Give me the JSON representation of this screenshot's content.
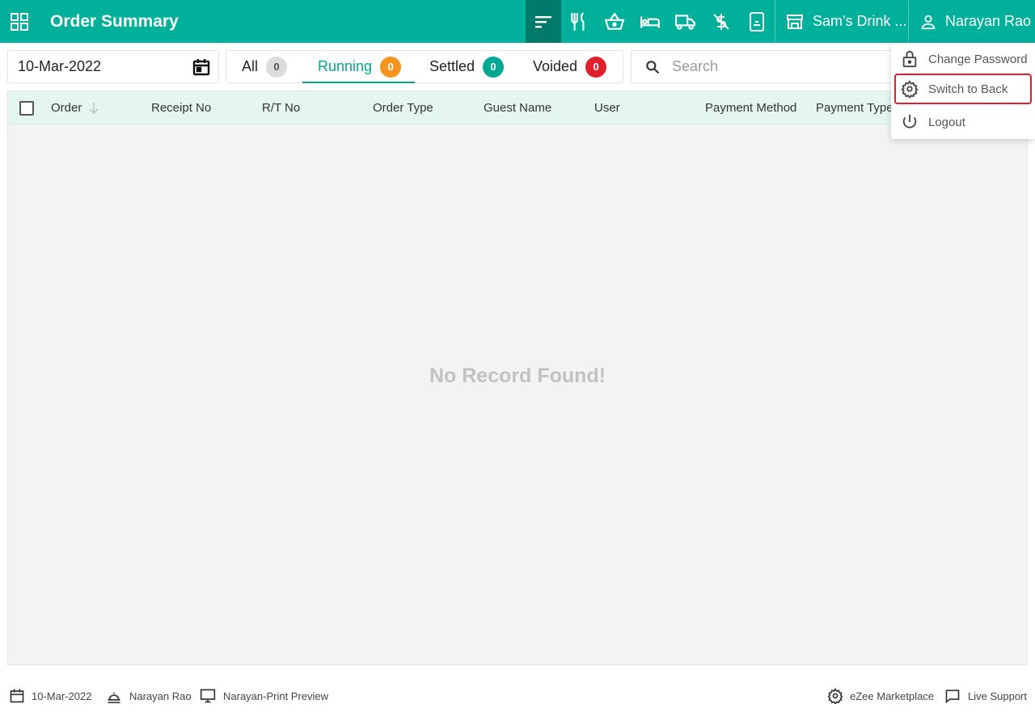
{
  "header": {
    "title": "Order Summary",
    "icons": [
      "sort-icon",
      "restaurant-icon",
      "basket-icon",
      "bed-icon",
      "truck-icon",
      "no-tip-icon",
      "tablet-icon"
    ],
    "outlet": "Sam's Drink ...",
    "user": "Narayan Rao"
  },
  "toolbar": {
    "date": "10-Mar-2022",
    "tabs": [
      {
        "label": "All",
        "count": "0",
        "color": "#dcdcdc",
        "text_color": "#555555"
      },
      {
        "label": "Running",
        "count": "0",
        "color": "#f7931e",
        "text_color": "#ffffff"
      },
      {
        "label": "Settled",
        "count": "0",
        "color": "#00a892",
        "text_color": "#ffffff"
      },
      {
        "label": "Voided",
        "count": "0",
        "color": "#e0202c",
        "text_color": "#ffffff"
      }
    ],
    "active_tab": "Running",
    "search_placeholder": "Search"
  },
  "table": {
    "columns": [
      "Order",
      "Receipt No",
      "R/T No",
      "Order Type",
      "Guest Name",
      "User",
      "Payment Method",
      "Payment Type"
    ],
    "empty_message": "No Record Found!"
  },
  "user_menu": {
    "items": [
      {
        "label": "Change Password",
        "icon": "lock-icon"
      },
      {
        "label": "Switch to Back",
        "icon": "gear-icon",
        "highlighted": true
      },
      {
        "label": "Logout",
        "icon": "power-icon"
      }
    ]
  },
  "footer": {
    "date": "10-Mar-2022",
    "user": "Narayan Rao",
    "printer": "Narayan-Print Preview",
    "marketplace": "eZee Marketplace",
    "support": "Live Support"
  },
  "colors": {
    "primary": "#00b09b",
    "primary_dark": "#007a6b",
    "header_row": "#e4f5f2",
    "highlight_border": "#e0202c"
  }
}
